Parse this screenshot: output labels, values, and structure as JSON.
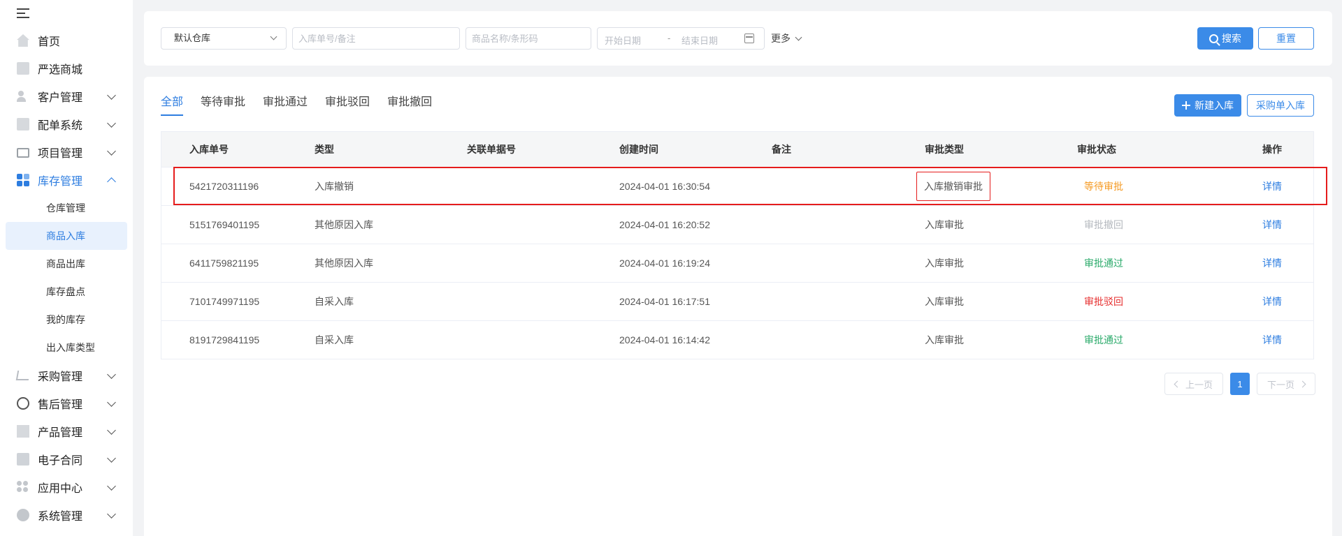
{
  "sidebar": {
    "items": [
      {
        "label": "首页",
        "icon": "home-icon"
      },
      {
        "label": "严选商城",
        "icon": "shop-icon"
      },
      {
        "label": "客户管理",
        "icon": "user-icon"
      },
      {
        "label": "配单系统",
        "icon": "doc-icon"
      },
      {
        "label": "项目管理",
        "icon": "folder-icon"
      },
      {
        "label": "库存管理",
        "icon": "inventory-icon"
      },
      {
        "label": "采购管理",
        "icon": "cart-icon"
      },
      {
        "label": "售后管理",
        "icon": "headset-icon"
      },
      {
        "label": "产品管理",
        "icon": "box-icon"
      },
      {
        "label": "电子合同",
        "icon": "contract-icon"
      },
      {
        "label": "应用中心",
        "icon": "apps-icon"
      },
      {
        "label": "系统管理",
        "icon": "gear-icon"
      }
    ],
    "sub_items": [
      "仓库管理",
      "商品入库",
      "商品出库",
      "库存盘点",
      "我的库存",
      "出入库类型"
    ],
    "active_sub": "商品入库"
  },
  "filters": {
    "warehouse": "默认仓库",
    "order_placeholder": "入库单号/备注",
    "product_placeholder": "商品名称/条形码",
    "start_date": "开始日期",
    "date_sep": "-",
    "end_date": "结束日期",
    "more": "更多",
    "search": "搜索",
    "reset": "重置"
  },
  "tabs": [
    "全部",
    "等待审批",
    "审批通过",
    "审批驳回",
    "审批撤回"
  ],
  "actions": {
    "new": "新建入库",
    "purchase": "采购单入库"
  },
  "table": {
    "headers": [
      "入库单号",
      "类型",
      "关联单据号",
      "创建时间",
      "备注",
      "审批类型",
      "审批状态",
      "操作"
    ],
    "rows": [
      {
        "id": "5421720311196",
        "type": "入库撤销",
        "ref": "",
        "time": "2024-04-01 16:30:54",
        "note": "",
        "approval_type": "入库撤销审批",
        "status": "等待审批",
        "action": "详情"
      },
      {
        "id": "5151769401195",
        "type": "其他原因入库",
        "ref": "",
        "time": "2024-04-01 16:20:52",
        "note": "",
        "approval_type": "入库审批",
        "status": "审批撤回",
        "action": "详情"
      },
      {
        "id": "6411759821195",
        "type": "其他原因入库",
        "ref": "",
        "time": "2024-04-01 16:19:24",
        "note": "",
        "approval_type": "入库审批",
        "status": "审批通过",
        "action": "详情"
      },
      {
        "id": "7101749971195",
        "type": "自采入库",
        "ref": "",
        "time": "2024-04-01 16:17:51",
        "note": "",
        "approval_type": "入库审批",
        "status": "审批驳回",
        "action": "详情"
      },
      {
        "id": "8191729841195",
        "type": "自采入库",
        "ref": "",
        "time": "2024-04-01 16:14:42",
        "note": "",
        "approval_type": "入库审批",
        "status": "审批通过",
        "action": "详情"
      }
    ]
  },
  "pagination": {
    "prev": "上一页",
    "current": "1",
    "next": "下一页"
  },
  "colors": {
    "accent": "#3b8be8",
    "waiting": "#f59a23",
    "revoked": "#b4b8be",
    "passed": "#2aaa6a",
    "rejected": "#e62e2e",
    "highlight": "#e51c1c"
  }
}
